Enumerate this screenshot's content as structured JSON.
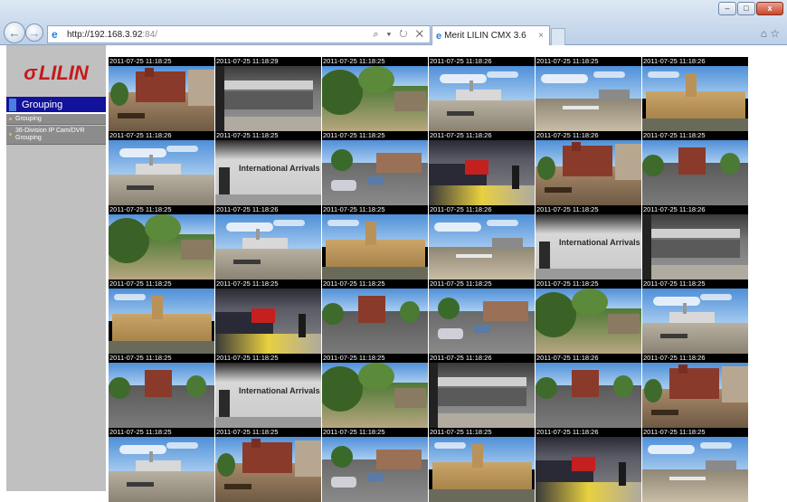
{
  "browser": {
    "url_main": "http://192.168.3.92",
    "url_port": ":84/",
    "address_tools": "⌕ ▾ ↻ ✕",
    "tab_title": "Merit LILIN CMX 3.6",
    "tab_close": "×",
    "window_minimize": "–",
    "window_maximize": "□",
    "window_close": "x"
  },
  "sidebar": {
    "logo_mark": "σ",
    "logo_text": "LILIN",
    "header": "Grouping",
    "items": [
      {
        "label": "Grouping"
      },
      {
        "label": "36-Division IP Cam/DVR Grouping"
      }
    ]
  },
  "colors": {
    "brand_red": "#c41a1a",
    "header_blue": "#12129c",
    "sidebar_gray": "#c0c0c0"
  },
  "cameras": [
    {
      "timestamp": "2011-07-25 11:18:25",
      "scene": "street-red"
    },
    {
      "timestamp": "2011-07-25 11:18:29",
      "scene": "station"
    },
    {
      "timestamp": "2011-07-25 11:18:25",
      "scene": "park"
    },
    {
      "timestamp": "2011-07-25 11:18:26",
      "scene": "river"
    },
    {
      "timestamp": "2011-07-25 11:18:25",
      "scene": "river2"
    },
    {
      "timestamp": "2011-07-25 11:18:26",
      "scene": "palace"
    },
    {
      "timestamp": "2011-07-25 11:18:26",
      "scene": "river"
    },
    {
      "timestamp": "2011-07-25 11:18:25",
      "scene": "arrivals"
    },
    {
      "timestamp": "2011-07-25 11:18:25",
      "scene": "road"
    },
    {
      "timestamp": "2011-07-25 11:18:26",
      "scene": "train"
    },
    {
      "timestamp": "2011-07-25 11:18:26",
      "scene": "street-red"
    },
    {
      "timestamp": "2011-07-25 11:18:25",
      "scene": "road2"
    },
    {
      "timestamp": "2011-07-25 11:18:25",
      "scene": "park"
    },
    {
      "timestamp": "2011-07-25 11:18:26",
      "scene": "river"
    },
    {
      "timestamp": "2011-07-25 11:18:25",
      "scene": "palace"
    },
    {
      "timestamp": "2011-07-25 11:18:26",
      "scene": "river2"
    },
    {
      "timestamp": "2011-07-25 11:18:25",
      "scene": "arrivals"
    },
    {
      "timestamp": "2011-07-25 11:18:26",
      "scene": "station"
    },
    {
      "timestamp": "2011-07-25 11:18:25",
      "scene": "palace"
    },
    {
      "timestamp": "2011-07-25 11:18:25",
      "scene": "train"
    },
    {
      "timestamp": "2011-07-25 11:18:25",
      "scene": "road2"
    },
    {
      "timestamp": "2011-07-25 11:18:25",
      "scene": "road"
    },
    {
      "timestamp": "2011-07-25 11:18:25",
      "scene": "park"
    },
    {
      "timestamp": "2011-07-25 11:18:25",
      "scene": "river"
    },
    {
      "timestamp": "2011-07-25 11:18:25",
      "scene": "road2"
    },
    {
      "timestamp": "2011-07-25 11:18:25",
      "scene": "arrivals"
    },
    {
      "timestamp": "2011-07-25 11:18:25",
      "scene": "park"
    },
    {
      "timestamp": "2011-07-25 11:18:26",
      "scene": "station"
    },
    {
      "timestamp": "2011-07-25 11:18:26",
      "scene": "road2"
    },
    {
      "timestamp": "2011-07-25 11:18:26",
      "scene": "street-red"
    },
    {
      "timestamp": "2011-07-25 11:18:25",
      "scene": "river"
    },
    {
      "timestamp": "2011-07-25 11:18:25",
      "scene": "street-red"
    },
    {
      "timestamp": "2011-07-25 11:18:25",
      "scene": "road"
    },
    {
      "timestamp": "2011-07-25 11:18:25",
      "scene": "palace"
    },
    {
      "timestamp": "2011-07-25 11:18:26",
      "scene": "train"
    },
    {
      "timestamp": "2011-07-25 11:18:25",
      "scene": "river2"
    }
  ]
}
